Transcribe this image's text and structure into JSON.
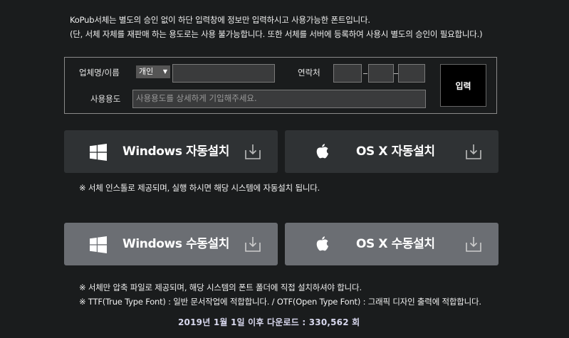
{
  "notice": {
    "line1": "KoPub서체는 별도의 승인 없이 하단 입력창에 정보만 입력하시고 사용가능한 폰트입니다.",
    "line2": "(단, 서체 자체를 재판매 하는 용도로는 사용 불가능합니다. 또한 서체를 서버에 등록하여 사용시 별도의 승인이 필요합니다.)"
  },
  "form": {
    "company_label": "업체명/이름",
    "type_select_value": "개인",
    "company_value": "",
    "contact_label": "연락처",
    "phone1": "",
    "phone2": "",
    "phone3": "",
    "usage_label": "사용용도",
    "usage_placeholder": "사용용도를 상세하게 기입해주세요.",
    "submit_label": "입력"
  },
  "auto_install": {
    "windows_label": "Windows 자동설치",
    "mac_label": "OS X 자동설치",
    "note": "※ 서체 인스톨로 제공되며, 실행 하시면 해당 시스템에 자동설치 됩니다."
  },
  "manual_install": {
    "windows_label": "Windows 수동설치",
    "mac_label": "OS X 수동설치",
    "note1": "※ 서체만 압축 파일로 제공되며, 해당 시스템의 폰트 폴더에 직접 설치하셔야 합니다.",
    "note2": "※ TTF(True Type Font) : 일반 문서작업에 적합합니다. / OTF(Open Type Font) : 그래픽 디자인 출력에 적합합니다."
  },
  "download_count": "2019년 1월 1일 이후 다운로드 : 330,562 회",
  "icons": {
    "windows": "windows-logo-icon",
    "mac": "apple-logo-icon",
    "download": "download-tray-icon",
    "select": "caret-down-icon"
  },
  "colors": {
    "background": "#1a1c1d",
    "auto_button": "#2f3234",
    "manual_button": "#6b6e73",
    "count_text": "#d8d8ee"
  }
}
